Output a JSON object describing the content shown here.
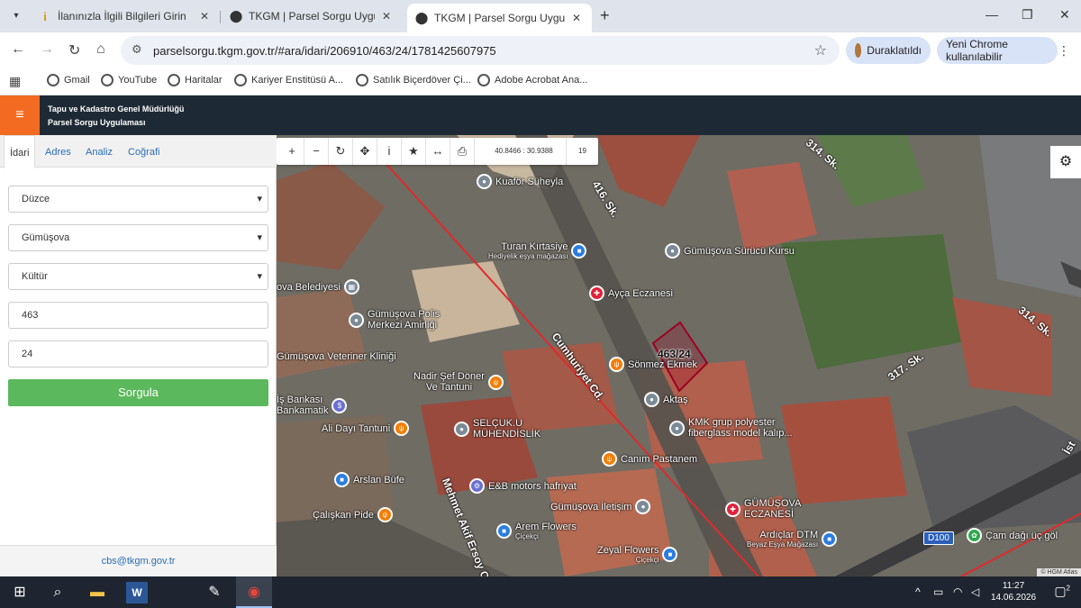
{
  "browser": {
    "tabs": [
      {
        "title": "İlanınızla İlgili Bilgileri Girin",
        "icon": "info-favicon",
        "active": false
      },
      {
        "title": "TKGM | Parsel Sorgu Uygulaması",
        "icon": "location-pin-favicon",
        "active": false
      },
      {
        "title": "TKGM | Parsel Sorgu Uygulaması",
        "icon": "location-pin-favicon",
        "active": true
      }
    ],
    "url": "parselsorgu.tkgm.gov.tr/#ara/idari/206910/463/24/1781425607975",
    "paused_label": "Duraklatıldı",
    "update_label": "Yeni Chrome kullanılabilir",
    "bookmarks": [
      "Gmail",
      "YouTube",
      "Haritalar",
      "Kariyer Enstitüsü A...",
      "Satılık Biçerdöver Çi...",
      "Adobe Acrobat Ana..."
    ]
  },
  "app": {
    "title_line1": "Tapu ve Kadastro Genel Müdürlüğü",
    "title_line2": "Parsel Sorgu Uygulaması",
    "brand_color": "#f26b21"
  },
  "panel": {
    "tabs": [
      "İdari",
      "Adres",
      "Analiz",
      "Coğrafi"
    ],
    "active_tab": "İdari",
    "il": "Düzce",
    "ilce": "Gümüşova",
    "mahalle": "Kültür",
    "ada": "463",
    "parsel": "24",
    "submit_label": "Sorgula",
    "footer_email": "cbs@tkgm.gov.tr"
  },
  "map": {
    "coordinates": "40.8466 : 30.9388",
    "zoom": "19",
    "parcel_label": "463/24",
    "attribution": "© HGM Atlas",
    "road_shield": "D100",
    "streets": {
      "s314_top": "314. Sk.",
      "s416": "416. Sk.",
      "s314_right": "314. Sk.",
      "s317": "317. Sk.",
      "cumhuriyet": "Cumhuriyet Cd.",
      "mehmet_akif": "Mehmet Akif Ersoy C",
      "ist": "İst"
    },
    "pois": {
      "kuafor": "Kuaför Süheyla",
      "turan": "Turan Kırtasiye",
      "turan_sub": "Hediyelik eşya mağazası",
      "surucu": "Gümüşova Sürücü Kursu",
      "belediye": "ova Belediyesi",
      "ayca": "Ayça Eczanesi",
      "polis1": "Gümüşova Polis",
      "polis2": "Merkezi Amirliği",
      "veteriner": "Gümüşova Veteriner Kliniği",
      "sonmez": "Sönmez Ekmek",
      "nadir1": "Nadir Şef Döner",
      "nadir2": "Ve Tantuni",
      "aktas": "Aktaş",
      "isbank1": "İş Bankası",
      "isbank2": "Bankamatik",
      "kmk1": "KMK grup polyester",
      "kmk2": "fiberglass model kalıp...",
      "alidayi": "Ali Dayı Tantuni",
      "selcuk1": "SELÇUK.U",
      "selcuk2": "MÜHENDİSLİK",
      "canim": "Canım Pastanem",
      "arslan": "Arslan Büfe",
      "eb": "E&B motors hafriyat",
      "iletisim": "Gümüşova İletişim",
      "gumusova_ecz1": "GÜMÜŞOVA",
      "gumusova_ecz2": "ECZANESİ",
      "caliskan": "Çalışkan Pide",
      "arem": "Arem Flowers",
      "arem_sub": "Çiçekçi",
      "ardiclar": "Ardıçlar DTM",
      "ardiclar_sub": "Beyaz Eşya Mağazası",
      "zeyal": "Zeyal Flowers",
      "zeyal_sub": "Çiçekçi",
      "camdagi": "Çam dağı üç göl"
    }
  },
  "taskbar": {
    "time": "11:27",
    "date": "14.06.2026",
    "notifications": "2"
  }
}
